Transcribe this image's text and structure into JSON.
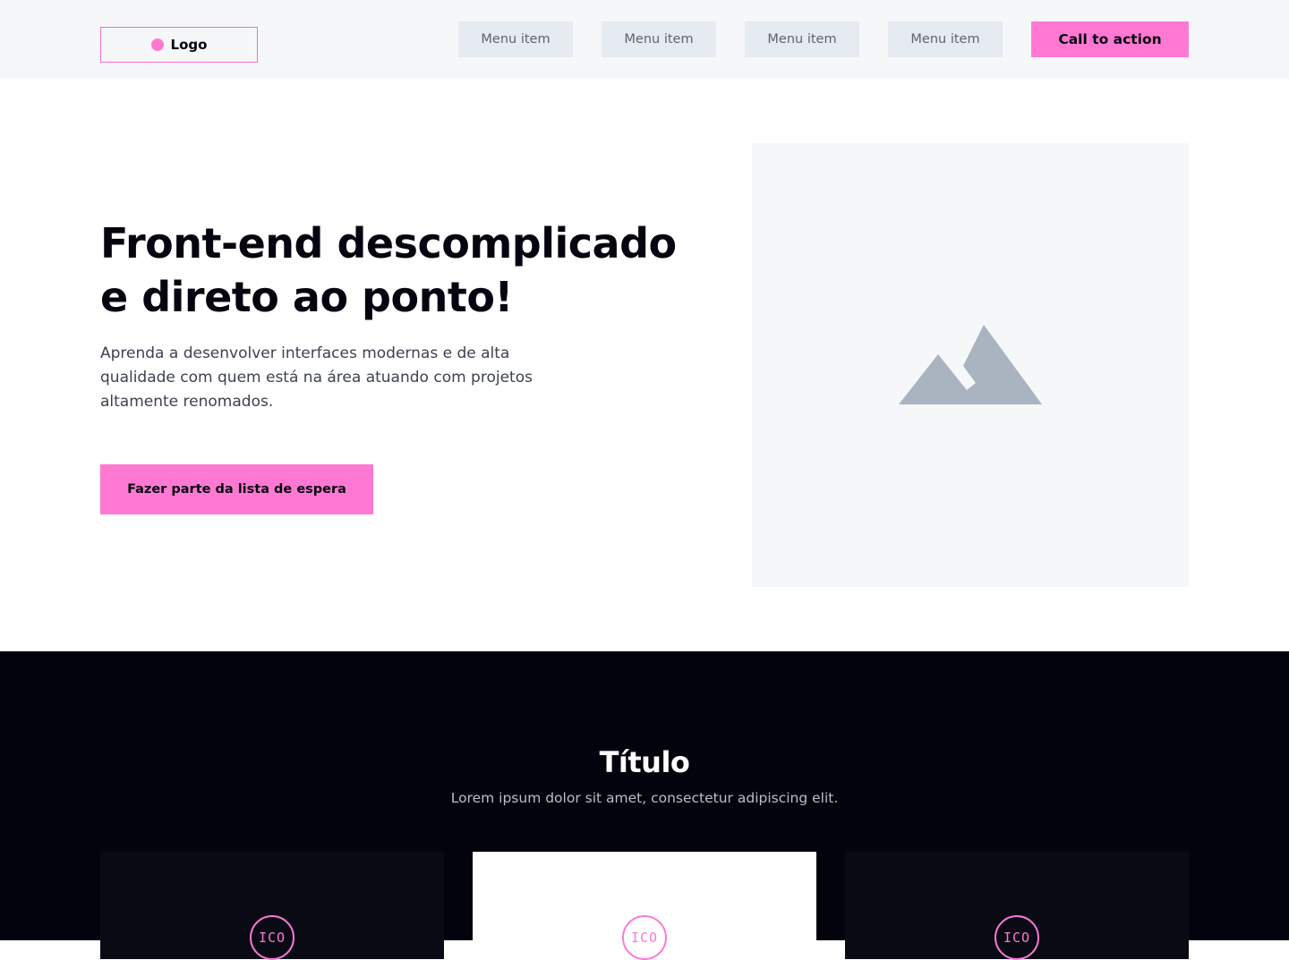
{
  "header": {
    "logo_label": "Logo",
    "menu": [
      "Menu item",
      "Menu item",
      "Menu item",
      "Menu item"
    ],
    "cta_label": "Call to action"
  },
  "hero": {
    "title_line1": "Front-end descomplicado",
    "title_line2": "e direto ao ponto!",
    "subtitle": "Aprenda a desenvolver interfaces modernas e de alta qualidade com quem está na área atuando com projetos altamente renomados.",
    "button_label": "Fazer parte da lista de espera",
    "image_icon": "image-placeholder-icon"
  },
  "section": {
    "title": "Título",
    "subtitle": "Lorem ipsum dolor sit amet, consectetur adipiscing elit.",
    "cards": [
      {
        "icon_text": "ICO"
      },
      {
        "icon_text": "ICO"
      },
      {
        "icon_text": "ICO"
      }
    ]
  },
  "colors": {
    "accent": "#ff79d3",
    "dark_bg": "#03030d",
    "header_bg": "#f6f7f9",
    "menu_bg": "#e6ebf1",
    "placeholder_icon": "#a9b4c0"
  }
}
